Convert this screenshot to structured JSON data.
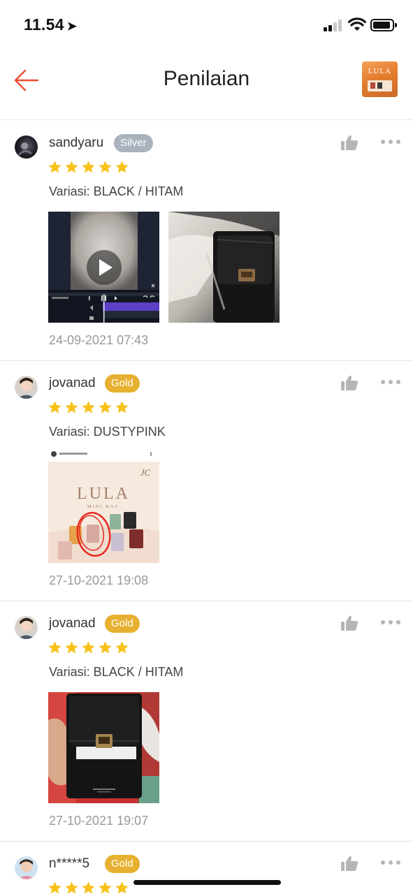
{
  "status_bar": {
    "time": "11.54"
  },
  "header": {
    "title": "Penilaian",
    "product_thumb_label": "LULA"
  },
  "colors": {
    "accent": "#ee4d2d",
    "star": "#f8c21c",
    "badge_gold": "#e7b030",
    "badge_silver": "#a9b2bd"
  },
  "reviews": [
    {
      "username": "sandyaru",
      "badge": "Silver",
      "rating": 5,
      "variation": "Variasi: BLACK / HITAM",
      "media": [
        "video",
        "photo-black-bag"
      ],
      "timestamp": "24-09-2021 07:43"
    },
    {
      "username": "jovanad",
      "badge": "Gold",
      "rating": 5,
      "variation": "Variasi: DUSTYPINK",
      "media": [
        "photo-lula-mini-bag"
      ],
      "media_text": {
        "brand": "LULA",
        "sub": "MINI BAG"
      },
      "timestamp": "27-10-2021 19:08"
    },
    {
      "username": "jovanad",
      "badge": "Gold",
      "rating": 5,
      "variation": "Variasi: BLACK / HITAM",
      "media": [
        "photo-black-bag-hand"
      ],
      "timestamp": "27-10-2021 19:07"
    },
    {
      "username": "n*****5",
      "badge": "Gold",
      "rating": 5
    }
  ]
}
